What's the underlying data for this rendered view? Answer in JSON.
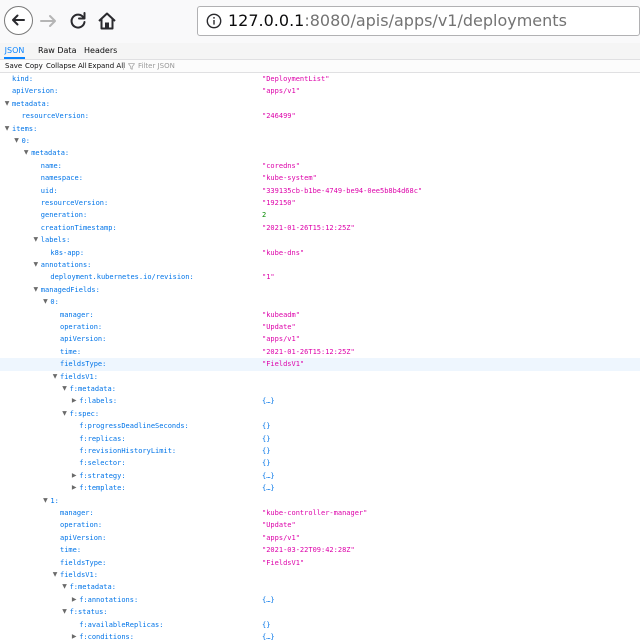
{
  "browser": {
    "url_host": "127.0.0.1",
    "url_rest": ":8080/apis/apps/v1/deployments"
  },
  "viewer": {
    "tabs": [
      {
        "label": "JSON",
        "active": true
      },
      {
        "label": "Raw Data",
        "active": false
      },
      {
        "label": "Headers",
        "active": false
      }
    ],
    "toolbar": {
      "save": "Save",
      "copy": "Copy",
      "collapse_all": "Collapse All",
      "expand_all": "Expand All",
      "filter_placeholder": "Filter JSON"
    }
  },
  "rows": [
    {
      "depth": 0,
      "twisty": "",
      "key": "kind:",
      "value": "\"DeploymentList\"",
      "type": "str"
    },
    {
      "depth": 0,
      "twisty": "",
      "key": "apiVersion:",
      "value": "\"apps/v1\"",
      "type": "str"
    },
    {
      "depth": 0,
      "twisty": "open",
      "key": "metadata:",
      "value": "",
      "type": ""
    },
    {
      "depth": 1,
      "twisty": "",
      "key": "resourceVersion:",
      "value": "\"246499\"",
      "type": "str"
    },
    {
      "depth": 0,
      "twisty": "open",
      "key": "items:",
      "value": "",
      "type": ""
    },
    {
      "depth": 1,
      "twisty": "open",
      "key": "0:",
      "value": "",
      "type": ""
    },
    {
      "depth": 2,
      "twisty": "open",
      "key": "metadata:",
      "value": "",
      "type": ""
    },
    {
      "depth": 3,
      "twisty": "",
      "key": "name:",
      "value": "\"coredns\"",
      "type": "str"
    },
    {
      "depth": 3,
      "twisty": "",
      "key": "namespace:",
      "value": "\"kube-system\"",
      "type": "str"
    },
    {
      "depth": 3,
      "twisty": "",
      "key": "uid:",
      "value": "\"339135cb-b1be-4749-be94-0ee5b8b4d68c\"",
      "type": "str"
    },
    {
      "depth": 3,
      "twisty": "",
      "key": "resourceVersion:",
      "value": "\"192150\"",
      "type": "str"
    },
    {
      "depth": 3,
      "twisty": "",
      "key": "generation:",
      "value": "2",
      "type": "num"
    },
    {
      "depth": 3,
      "twisty": "",
      "key": "creationTimestamp:",
      "value": "\"2021-01-26T15:12:25Z\"",
      "type": "str"
    },
    {
      "depth": 3,
      "twisty": "open",
      "key": "labels:",
      "value": "",
      "type": ""
    },
    {
      "depth": 4,
      "twisty": "",
      "key": "k8s-app:",
      "value": "\"kube-dns\"",
      "type": "str"
    },
    {
      "depth": 3,
      "twisty": "open",
      "key": "annotations:",
      "value": "",
      "type": ""
    },
    {
      "depth": 4,
      "twisty": "",
      "key": "deployment.kubernetes.io/revision:",
      "value": "\"1\"",
      "type": "str"
    },
    {
      "depth": 3,
      "twisty": "open",
      "key": "managedFields:",
      "value": "",
      "type": ""
    },
    {
      "depth": 4,
      "twisty": "open",
      "key": "0:",
      "value": "",
      "type": ""
    },
    {
      "depth": 5,
      "twisty": "",
      "key": "manager:",
      "value": "\"kubeadm\"",
      "type": "str"
    },
    {
      "depth": 5,
      "twisty": "",
      "key": "operation:",
      "value": "\"Update\"",
      "type": "str"
    },
    {
      "depth": 5,
      "twisty": "",
      "key": "apiVersion:",
      "value": "\"apps/v1\"",
      "type": "str"
    },
    {
      "depth": 5,
      "twisty": "",
      "key": "time:",
      "value": "\"2021-01-26T15:12:25Z\"",
      "type": "str"
    },
    {
      "depth": 5,
      "twisty": "",
      "key": "fieldsType:",
      "value": "\"FieldsV1\"",
      "type": "str",
      "highlight": true
    },
    {
      "depth": 5,
      "twisty": "open",
      "key": "fieldsV1:",
      "value": "",
      "type": ""
    },
    {
      "depth": 6,
      "twisty": "open",
      "key": "f:metadata:",
      "value": "",
      "type": ""
    },
    {
      "depth": 7,
      "twisty": "closed",
      "key": "f:labels:",
      "value": "{…}",
      "type": "obj"
    },
    {
      "depth": 6,
      "twisty": "open",
      "key": "f:spec:",
      "value": "",
      "type": ""
    },
    {
      "depth": 7,
      "twisty": "",
      "key": "f:progressDeadlineSeconds:",
      "value": "{}",
      "type": "obj"
    },
    {
      "depth": 7,
      "twisty": "",
      "key": "f:replicas:",
      "value": "{}",
      "type": "obj"
    },
    {
      "depth": 7,
      "twisty": "",
      "key": "f:revisionHistoryLimit:",
      "value": "{}",
      "type": "obj"
    },
    {
      "depth": 7,
      "twisty": "",
      "key": "f:selector:",
      "value": "{}",
      "type": "obj"
    },
    {
      "depth": 7,
      "twisty": "closed",
      "key": "f:strategy:",
      "value": "{…}",
      "type": "obj"
    },
    {
      "depth": 7,
      "twisty": "closed",
      "key": "f:template:",
      "value": "{…}",
      "type": "obj"
    },
    {
      "depth": 4,
      "twisty": "open",
      "key": "1:",
      "value": "",
      "type": ""
    },
    {
      "depth": 5,
      "twisty": "",
      "key": "manager:",
      "value": "\"kube-controller-manager\"",
      "type": "str"
    },
    {
      "depth": 5,
      "twisty": "",
      "key": "operation:",
      "value": "\"Update\"",
      "type": "str"
    },
    {
      "depth": 5,
      "twisty": "",
      "key": "apiVersion:",
      "value": "\"apps/v1\"",
      "type": "str"
    },
    {
      "depth": 5,
      "twisty": "",
      "key": "time:",
      "value": "\"2021-03-22T09:42:28Z\"",
      "type": "str"
    },
    {
      "depth": 5,
      "twisty": "",
      "key": "fieldsType:",
      "value": "\"FieldsV1\"",
      "type": "str"
    },
    {
      "depth": 5,
      "twisty": "open",
      "key": "fieldsV1:",
      "value": "",
      "type": ""
    },
    {
      "depth": 6,
      "twisty": "open",
      "key": "f:metadata:",
      "value": "",
      "type": ""
    },
    {
      "depth": 7,
      "twisty": "closed",
      "key": "f:annotations:",
      "value": "{…}",
      "type": "obj"
    },
    {
      "depth": 6,
      "twisty": "open",
      "key": "f:status:",
      "value": "",
      "type": ""
    },
    {
      "depth": 7,
      "twisty": "",
      "key": "f:availableReplicas:",
      "value": "{}",
      "type": "obj"
    },
    {
      "depth": 7,
      "twisty": "closed",
      "key": "f:conditions:",
      "value": "{…}",
      "type": "obj"
    }
  ]
}
